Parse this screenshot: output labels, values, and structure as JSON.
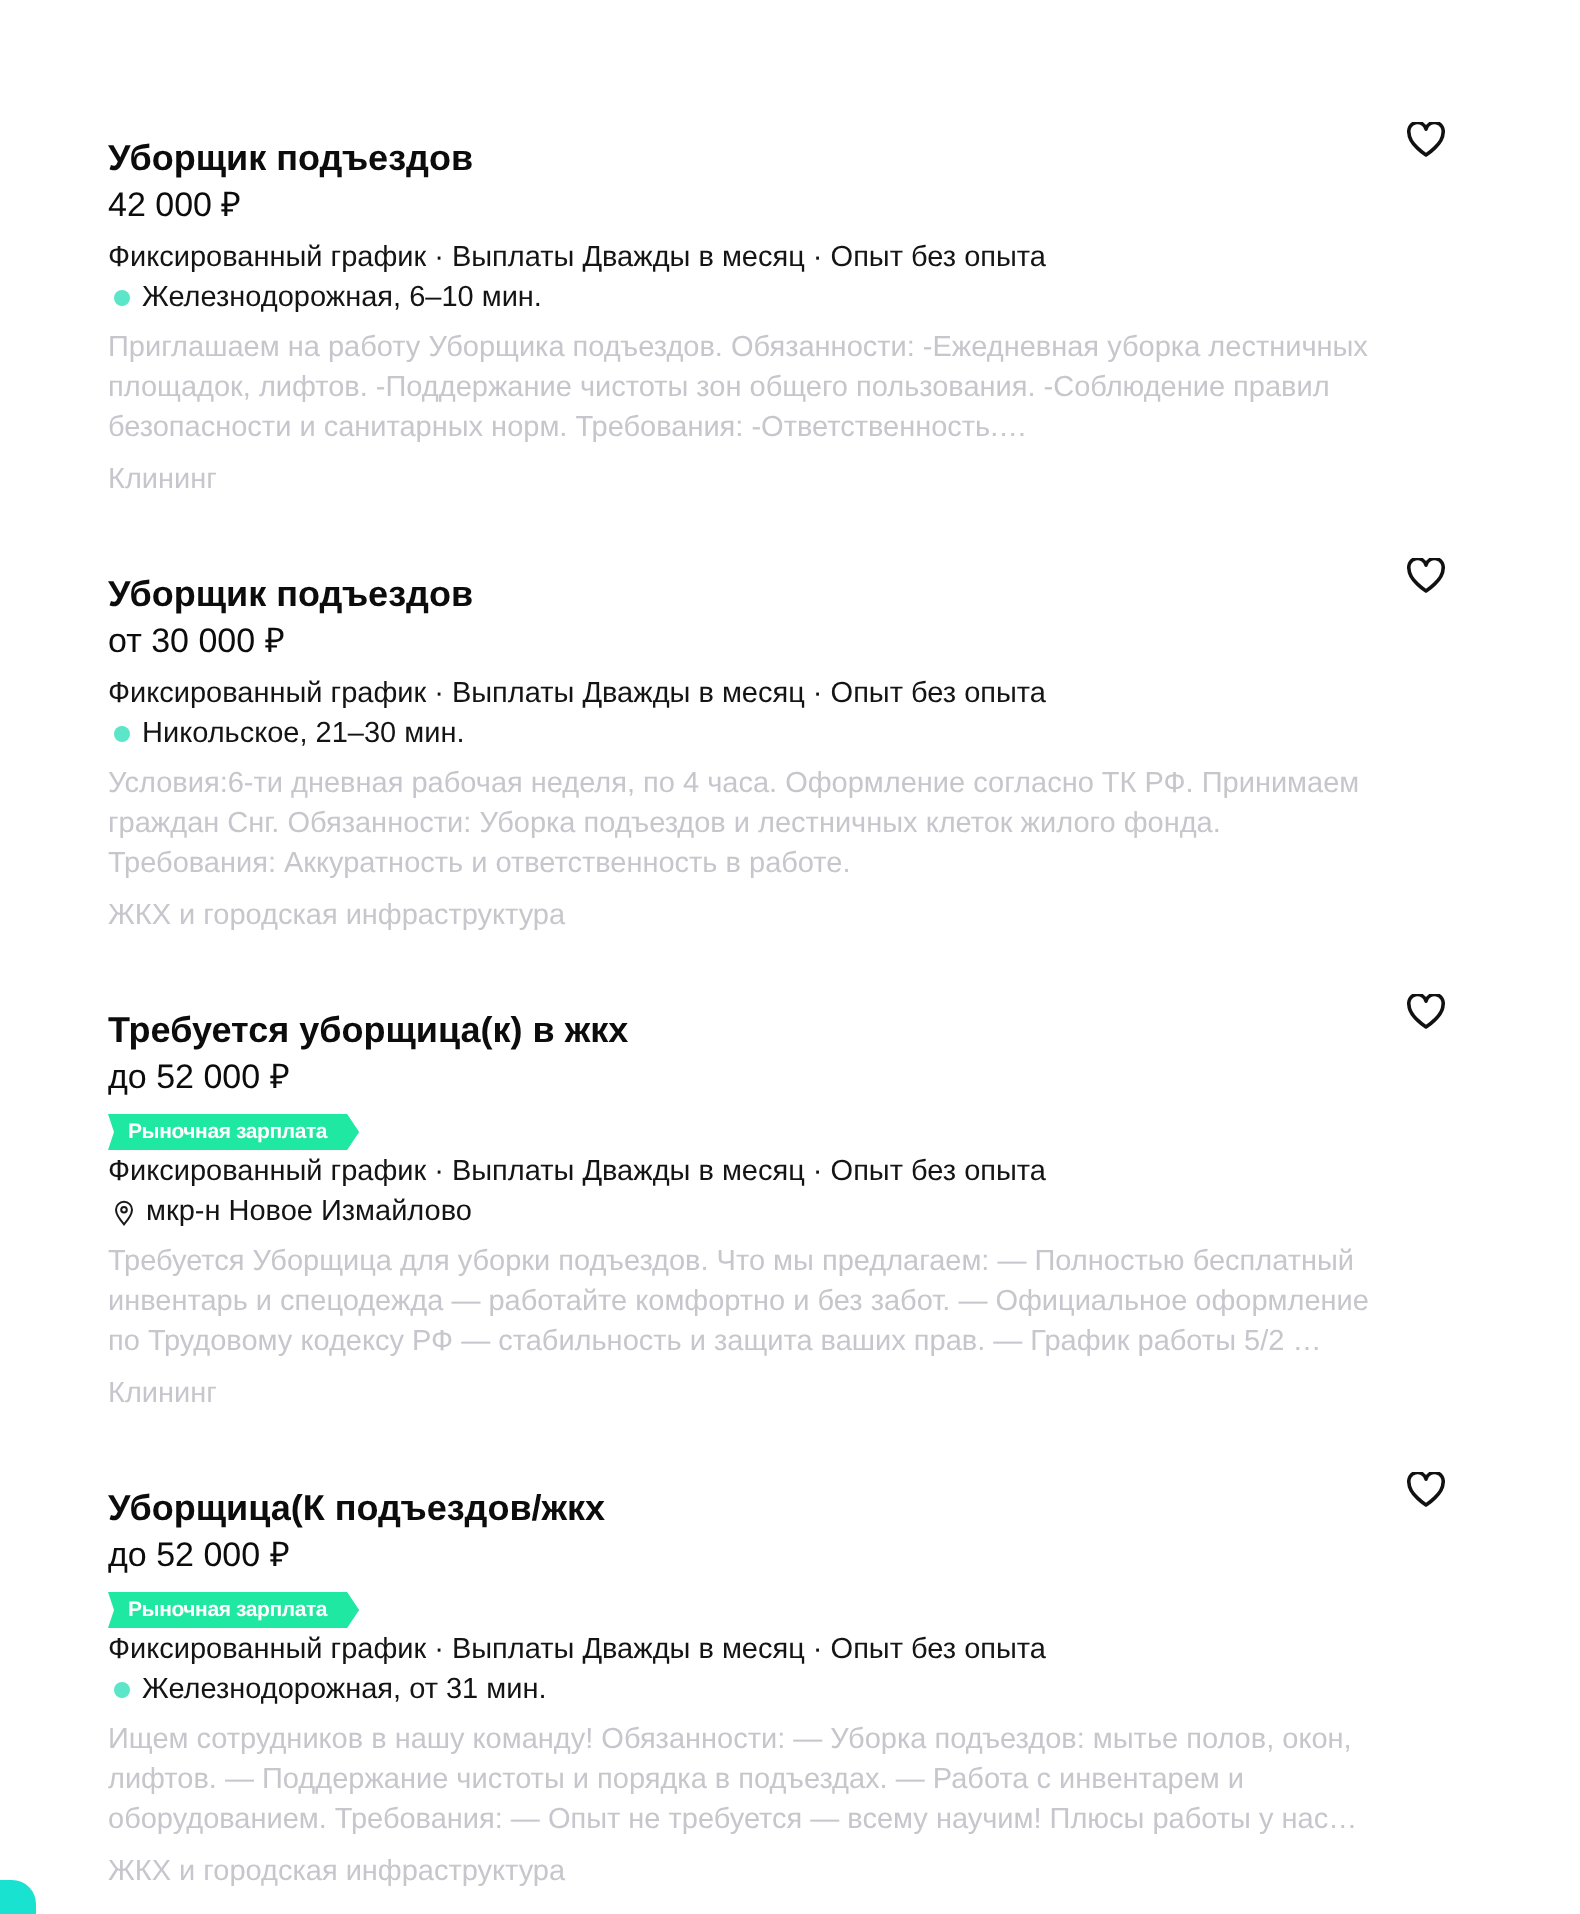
{
  "vacancies": [
    {
      "title": "Уборщик подъездов",
      "salary": "42 000 ₽",
      "saved": false,
      "conditions": "Фиксированный график · Выплаты Дважды в месяц · Опыт без опыта",
      "location": {
        "kind": "metro",
        "name": "Железнодорожная, 6–10 мин.",
        "color": "#5ce6c9"
      },
      "description": "Приглашаем на работу Уборщика подъездов. Обязанности: -Ежедневная уборка лестничных площадок, лифтов. -Поддержание чистоты зон общего пользования. -Соблюдение правил безопасности и санитарных норм. Требования: -Ответственность.…",
      "category": "Клининг"
    },
    {
      "title": "Уборщик подъездов",
      "salary": "от 30 000 ₽",
      "saved": false,
      "conditions": "Фиксированный график · Выплаты Дважды в месяц · Опыт без опыта",
      "location": {
        "kind": "metro",
        "name": "Никольское, 21–30 мин.",
        "color": "#5ce6c9"
      },
      "description": "Условия:6-ти дневная рабочая неделя, по 4 часа. Оформление согласно ТК РФ. Принимаем граждан Снг. Обязанности: Уборка подъездов и лестничных клеток жилого фонда. Требования: Аккуратность и ответственность в работе.",
      "category": "ЖКХ и городская инфраструктура"
    },
    {
      "title": "Требуется уборщица(к) в жкх",
      "salary": "до 52 000 ₽",
      "badge": "Рыночная зарплата",
      "saved": false,
      "conditions": "Фиксированный график · Выплаты Дважды в месяц · Опыт без опыта",
      "location": {
        "kind": "address",
        "name": "мкр-н Новое Измайлово"
      },
      "description": "Требуется Уборщица для уборки подъездов. Что мы предлагаем: — Полностью бесплатный инвентарь и спецодежда — работайте комфортно и без забот. — Официальное оформление по Трудовому кодексу РФ — стабильность и защита ваших прав. — График работы 5/2 …",
      "category": "Клининг"
    },
    {
      "title": "Уборщица(К подъездов/жкх",
      "salary": "до 52 000 ₽",
      "badge": "Рыночная зарплата",
      "saved": false,
      "conditions": "Фиксированный график · Выплаты Дважды в месяц · Опыт без опыта",
      "location": {
        "kind": "metro",
        "name": "Железнодорожная, от 31 мин.",
        "color": "#5ce6c9"
      },
      "description": "Ищем сотрудников в нашу команду! Обязанности: — Уборка подъездов: мытье полов, окон, лифтов. — Поддержание чистоты и порядка в подъездах. — Работа с инвентарем и оборудованием. Требования: — Опыт не требуется — всему научим! Плюсы работы у нас…",
      "category": "ЖКХ и городская инфраструктура"
    }
  ]
}
